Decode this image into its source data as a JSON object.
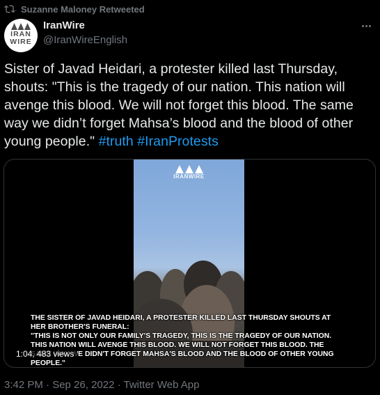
{
  "retweet": {
    "icon": "retweet-icon",
    "text": "Suzanne Maloney Retweeted"
  },
  "author": {
    "display_name": "IranWire",
    "handle": "@IranWireEnglish",
    "avatar_text_line1": "IRAN",
    "avatar_text_line2": "WIRE"
  },
  "tweet": {
    "text": "Sister of Javad Heidari, a protester killed last Thursday, shouts: \"This is the tragedy of our nation. This nation will avenge this blood. We will not forget this blood. The same way we didn’t forget Mahsa’s blood and the blood of other young people.\" ",
    "hashtags": [
      "#truth",
      "#IranProtests"
    ]
  },
  "video": {
    "watermark": "IRANWIRE",
    "caption_lines": [
      "THE SISTER OF JAVAD HEIDARI, A PROTESTER KILLED LAST THURSDAY SHOUTS AT",
      "HER BROTHER'S FUNERAL:",
      "\"THIS IS NOT ONLY OUR FAMILY'S TRAGEDY, THIS IS THE TRAGEDY OF OUR NATION.",
      "THIS NATION WILL AVENGE THIS BLOOD. WE WILL NOT FORGET THIS BLOOD. THE",
      "SAME WAY WE DIDN'T FORGET MAHSA'S BLOOD AND THE BLOOD OF OTHER YOUNG",
      "PEOPLE.\""
    ],
    "views_label": "1:04, 483 views"
  },
  "meta": {
    "timestamp": "3:42 PM · Sep 26, 2022 · Twitter Web App"
  },
  "colors": {
    "background": "#000000",
    "text": "#e7e9ea",
    "muted": "#71767b",
    "link": "#1d9bf0"
  }
}
